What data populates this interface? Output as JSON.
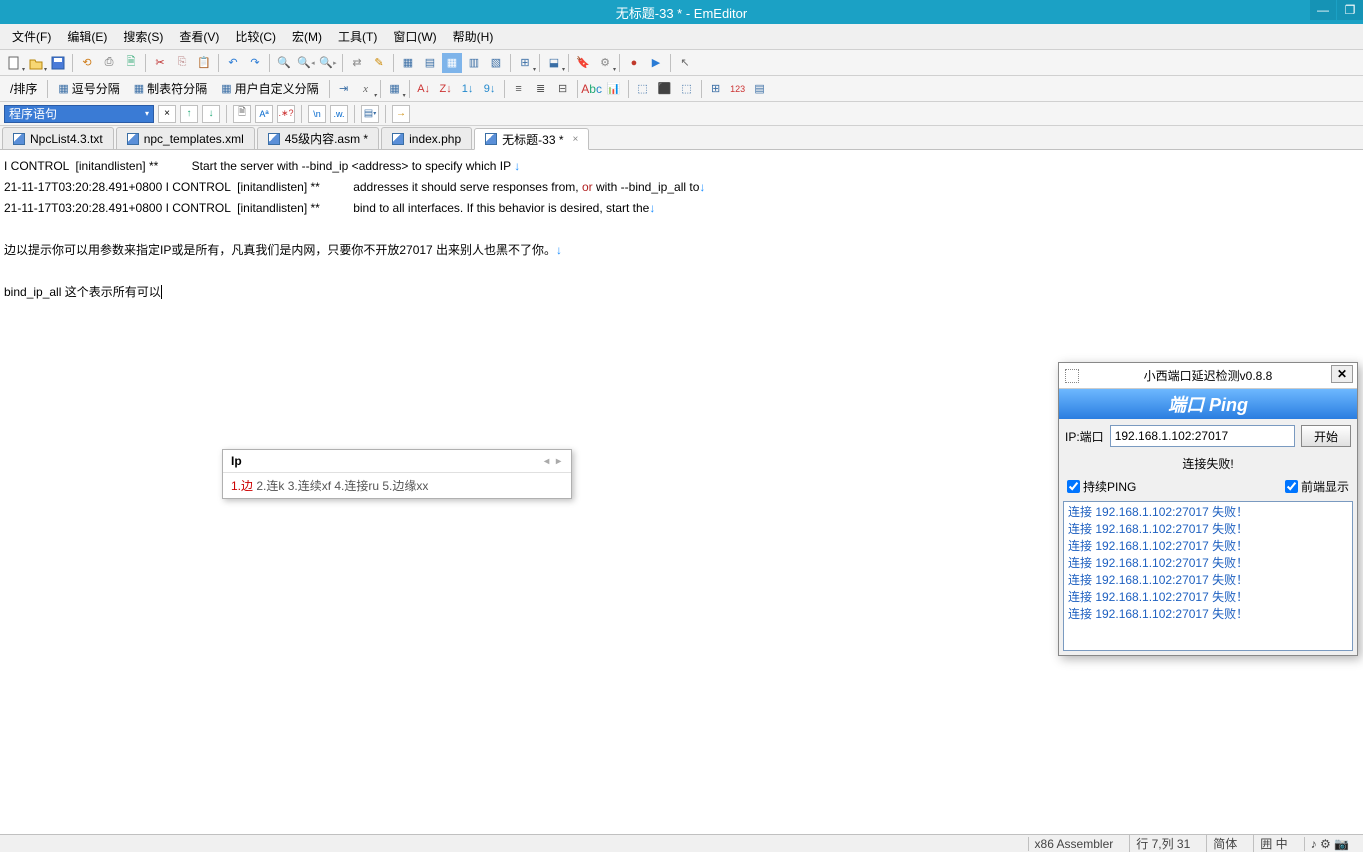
{
  "window": {
    "title": "无标题-33 * - EmEditor"
  },
  "menus": {
    "file": "文件(F)",
    "edit": "编辑(E)",
    "search": "搜索(S)",
    "view": "查看(V)",
    "compare": "比较(C)",
    "macro": "宏(M)",
    "tools": "工具(T)",
    "window": "窗口(W)",
    "help": "帮助(H)"
  },
  "toolbar3": {
    "combo": "程序语句"
  },
  "toolbar2": {
    "sort": "/排序",
    "comma": "逗号分隔",
    "tab": "制表符分隔",
    "user": "用户自定义分隔"
  },
  "tabs": [
    {
      "label": "NpcList4.3.txt",
      "active": false,
      "closeable": false
    },
    {
      "label": "npc_templates.xml",
      "active": false,
      "closeable": false
    },
    {
      "label": "45级内容.asm *",
      "active": false,
      "closeable": false
    },
    {
      "label": "index.php",
      "active": false,
      "closeable": false
    },
    {
      "label": "无标题-33 *",
      "active": true,
      "closeable": true
    }
  ],
  "editor": {
    "l1a": "I CONTROL  [initandlisten] **          Start the server with --bind_ip <address> to specify which IP ",
    "l2a": "21-11-17T03:20:28.491+0800 I CONTROL  [initandlisten] **          addresses it should serve responses from, ",
    "l2b": "or",
    "l2c": " with --bind_ip_all to",
    "l3a": "21-11-17T03:20:28.491+0800 I CONTROL  [initandlisten] **          bind to all interfaces. If this behavior is desired, start the",
    "l4": "",
    "l5": "边以提示你可以用参数来指定IP或是所有，凡真我们是内网，只要你不开放27017 出来别人也黑不了你。",
    "l6": "",
    "l7": "bind_ip_all 这个表示所有可以"
  },
  "ime": {
    "input": "Ip",
    "candidates": "1.边  2.连k  3.连续xf  4.连接ru  5.边缘xx",
    "cand1": "1.边"
  },
  "ping": {
    "title": "小西端口延迟检测v0.8.8",
    "banner": "端口 Ping",
    "ip_label": "IP:端口",
    "ip_value": "192.168.1.102:27017",
    "start": "开始",
    "status": "连接失败!",
    "chk_continuous": "持续PING",
    "chk_topmost": "前端显示",
    "log": [
      "连接 192.168.1.102:27017 失败！",
      "连接 192.168.1.102:27017 失败！",
      "连接 192.168.1.102:27017 失败！",
      "连接 192.168.1.102:27017 失败！",
      "连接 192.168.1.102:27017 失败！",
      "连接 192.168.1.102:27017 失败！",
      "连接 192.168.1.102:27017 失败！"
    ]
  },
  "status": {
    "lang": "x86 Assembler",
    "pos": "行 7,列 31",
    "enc": "简体",
    "ime": "囲 中",
    "misc": "♪ ⚙ 📷"
  }
}
